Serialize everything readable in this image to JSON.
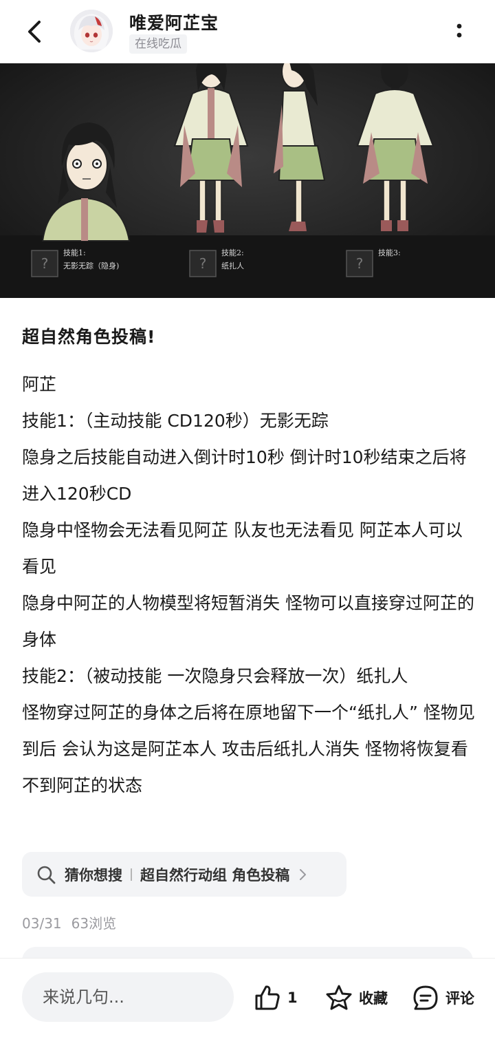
{
  "header": {
    "username": "唯爱阿芷宝",
    "user_tag": "在线吃瓜",
    "back_icon": "chevron-left-icon",
    "more_icon": "more-vertical-icon"
  },
  "banner": {
    "skills": [
      {
        "label": "技能1:",
        "name": "无影无踪（隐身)"
      },
      {
        "label": "技能2:",
        "name": "纸扎人"
      },
      {
        "label": "技能3:",
        "name": ""
      }
    ]
  },
  "post": {
    "title": "超自然角色投稿!",
    "paragraphs": [
      "阿芷",
      "技能1：（主动技能 CD120秒）无影无踪",
      "隐身之后技能自动进入倒计时10秒 倒计时10秒结束之后将进入120秒CD",
      "隐身中怪物会无法看见阿芷 队友也无法看见 阿芷本人可以看见",
      "隐身中阿芷的人物模型将短暂消失 怪物可以直接穿过阿芷的身体",
      "技能2：（被动技能 一次隐身只会释放一次）纸扎人",
      "怪物穿过阿芷的身体之后将在原地留下一个“纸扎人” 怪物见到后 会认为这是阿芷本人 攻击后纸扎人消失 怪物将恢复看不到阿芷的状态"
    ]
  },
  "search_suggestion": {
    "label": "猜你想搜",
    "query": "超自然行动组 角色投稿"
  },
  "meta": {
    "date": "03/31",
    "views": "63浏览"
  },
  "bottom_bar": {
    "comment_placeholder": "来说几句...",
    "like_count": "1",
    "favorite_label": "收藏",
    "comment_label": "评论"
  }
}
